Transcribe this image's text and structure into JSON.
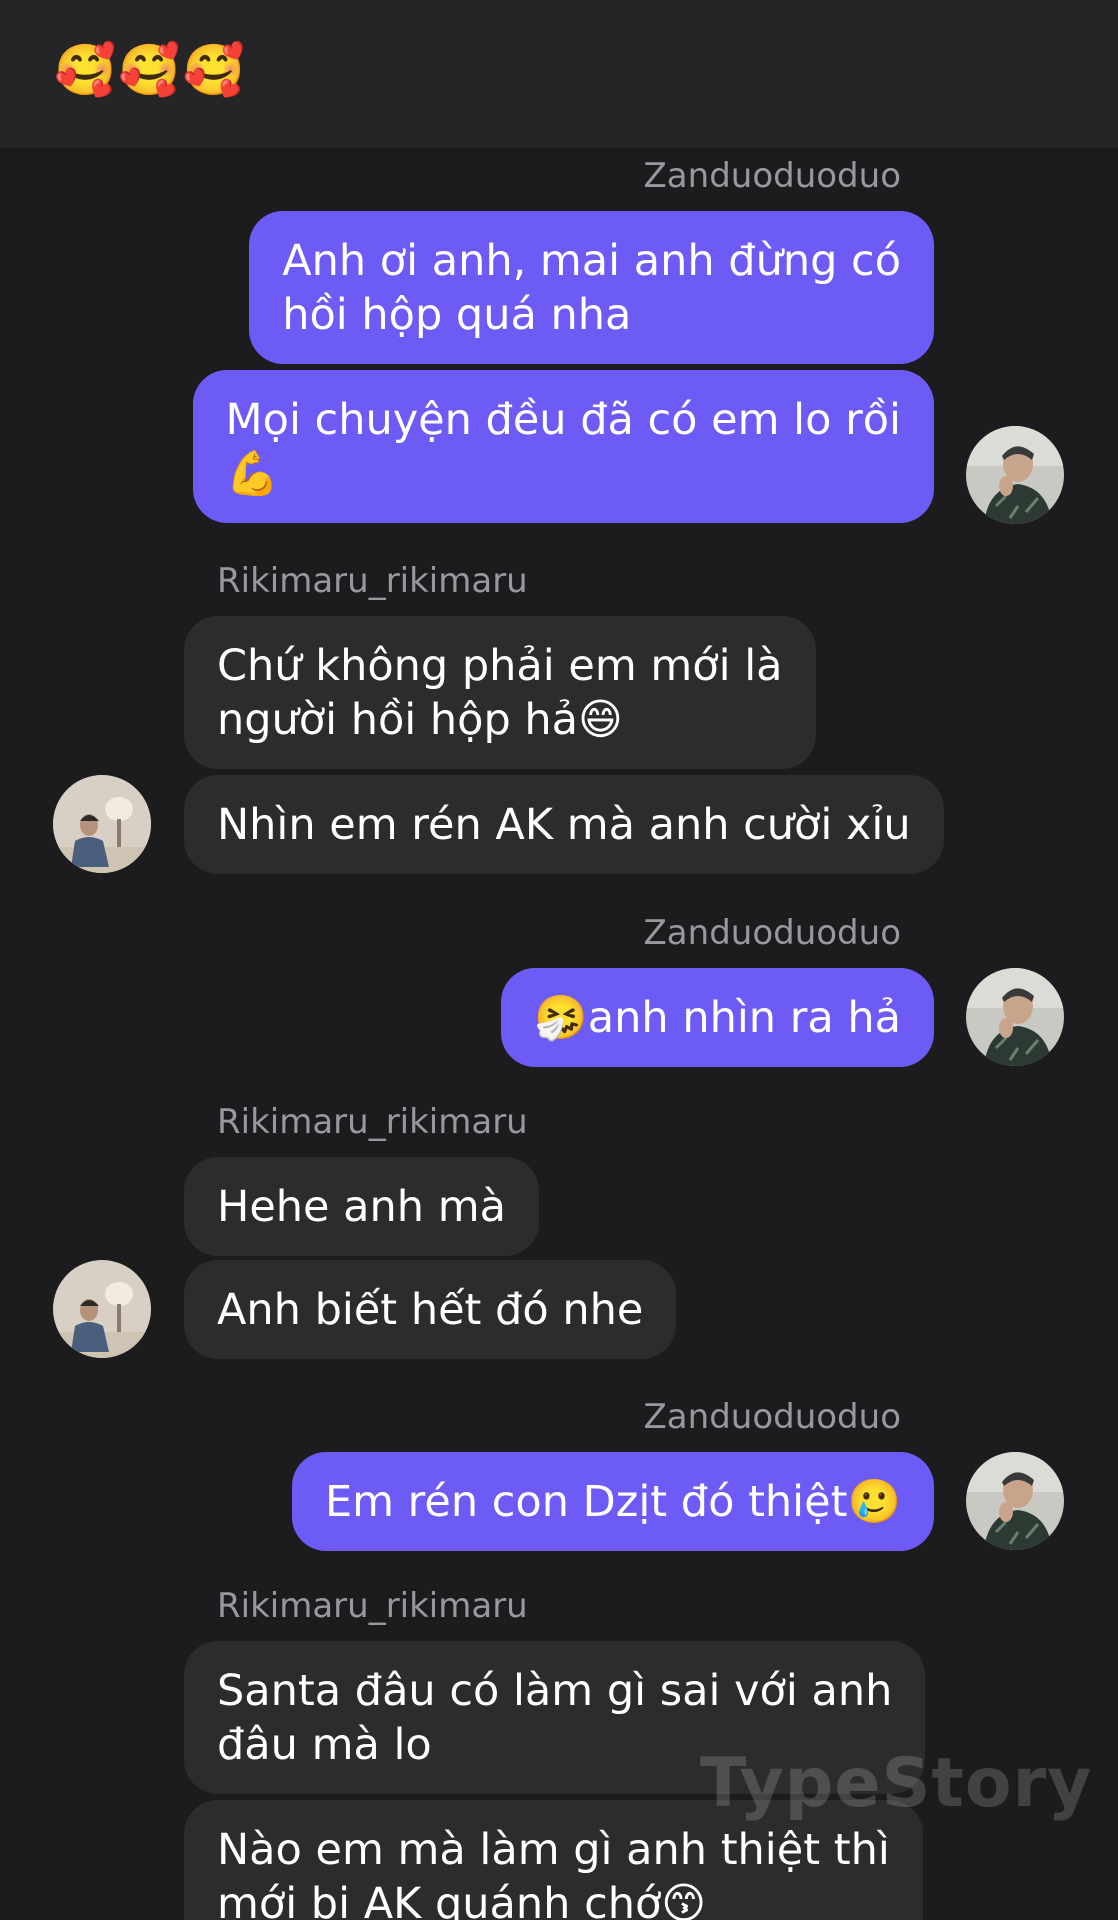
{
  "header": {
    "title": "🥰🥰🥰"
  },
  "users": {
    "me": "Zanduoduoduo",
    "them": "Rikimaru_rikimaru"
  },
  "groups": [
    {
      "sender": "Zanduoduoduo",
      "messages": [
        "Anh ơi anh, mai anh đừng có\nhồi hộp quá nha",
        "Mọi chuyện đều đã có em lo rồi\n💪"
      ]
    },
    {
      "sender": "Rikimaru_rikimaru",
      "messages": [
        "Chứ không phải em mới là\nngười hồi hộp hả😄",
        "Nhìn em rén AK mà anh cười xỉu"
      ]
    },
    {
      "sender": "Zanduoduoduo",
      "messages": [
        "🤧anh nhìn ra hả"
      ]
    },
    {
      "sender": "Rikimaru_rikimaru",
      "messages": [
        "Hehe anh mà",
        "Anh biết hết đó nhe"
      ]
    },
    {
      "sender": "Zanduoduoduo",
      "messages": [
        "Em rén con Dzịt đó thiệt🥲"
      ]
    },
    {
      "sender": "Rikimaru_rikimaru",
      "messages": [
        "Santa đâu có làm gì sai với anh\nđâu mà lo",
        "Nào em mà làm gì anh thiệt thì\nmới bị AK quánh chớ😙"
      ]
    }
  ],
  "watermark": "TypeStory",
  "colors": {
    "background": "#1c1c1e",
    "header": "#252527",
    "my_bubble": "#6c5cf5",
    "their_bubble": "#2c2c2e",
    "sender_text": "#98989d"
  }
}
